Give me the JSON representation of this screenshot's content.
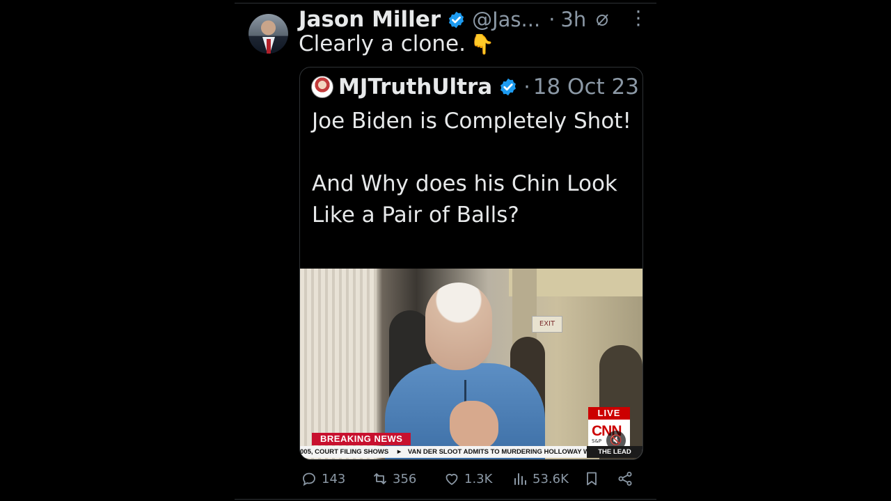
{
  "tweet": {
    "author_name": "Jason Miller",
    "author_handle": "@Jas...",
    "dot": "·",
    "time": "3h",
    "more_label": "⋮",
    "text": "Clearly a clone.",
    "emoji": "👇"
  },
  "quoted": {
    "author_name": "MJTruthUltra",
    "dot": "·",
    "date": "18 Oct 23",
    "line1": "Joe Biden is Completely Shot!",
    "line2": "And Why does his Chin Look Like a Pair of Balls?",
    "ellipsis": "..."
  },
  "media": {
    "live_label": "LIVE",
    "network_logo": "CNN",
    "network_sub": "S&P",
    "exit_sign": "EXIT",
    "breaking_label": "BREAKING NEWS",
    "ticker_left": "005, COURT FILING SHOWS",
    "ticker_arrow": "►",
    "ticker_right": "VAN DER SLOOT ADMITS TO MURDERING HOLLOWAY WI",
    "ticker_show": "THE LEAD",
    "mute_icon": "speaker-muted-icon"
  },
  "actions": {
    "replies": "143",
    "retweets": "356",
    "likes": "1.3K",
    "views": "53.6K"
  },
  "colors": {
    "background": "#000000",
    "text": "#e7e9ea",
    "secondary": "#8b98a5",
    "verified": "#1d9bf0",
    "border": "#2f3336",
    "breaking": "#c8102e",
    "cnn_red": "#cc0000"
  }
}
